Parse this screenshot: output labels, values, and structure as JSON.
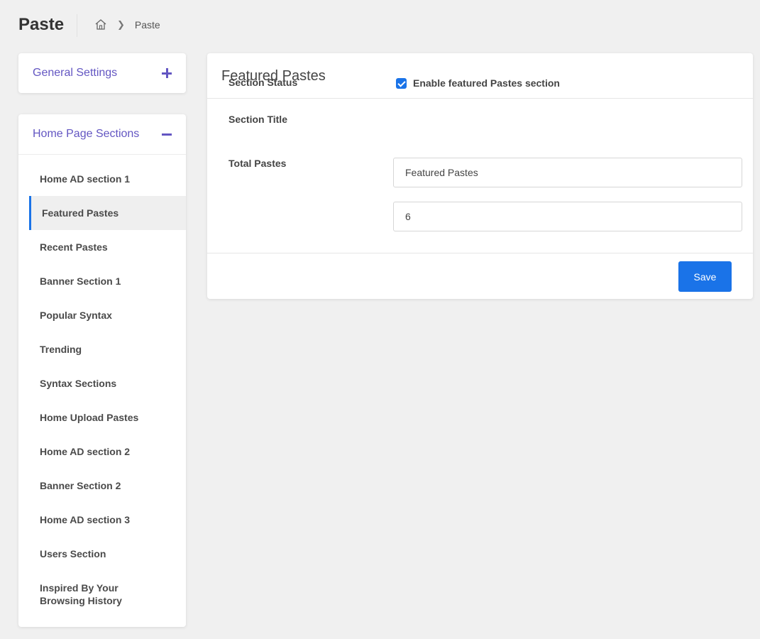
{
  "header": {
    "title": "Paste",
    "breadcrumb": {
      "home_icon": "home-icon",
      "current": "Paste"
    }
  },
  "general_settings": {
    "title": "General Settings",
    "icon": "plus-icon"
  },
  "home_sections": {
    "title": "Home Page Sections",
    "icon": "minus-icon",
    "active_index": 1,
    "items": [
      {
        "label": "Home AD section 1"
      },
      {
        "label": "Featured Pastes"
      },
      {
        "label": "Recent Pastes"
      },
      {
        "label": "Banner Section 1"
      },
      {
        "label": "Popular Syntax"
      },
      {
        "label": "Trending"
      },
      {
        "label": "Syntax Sections"
      },
      {
        "label": "Home Upload Pastes"
      },
      {
        "label": "Home AD section 2"
      },
      {
        "label": "Banner Section 2"
      },
      {
        "label": "Home AD section 3"
      },
      {
        "label": "Users Section"
      },
      {
        "label": "Inspired By Your Browsing History"
      }
    ]
  },
  "main": {
    "title": "Featured Pastes",
    "section_status_label": "Section Status",
    "enable_label": "Enable featured Pastes section",
    "enable_checked": true,
    "section_title_label": "Section Title",
    "section_title_value": "Featured Pastes",
    "total_pastes_label": "Total Pastes",
    "total_pastes_value": "6",
    "save_label": "Save"
  },
  "colors": {
    "accent": "#1a73e8",
    "link_purple": "#6356c2",
    "background": "#f0f0f0"
  }
}
